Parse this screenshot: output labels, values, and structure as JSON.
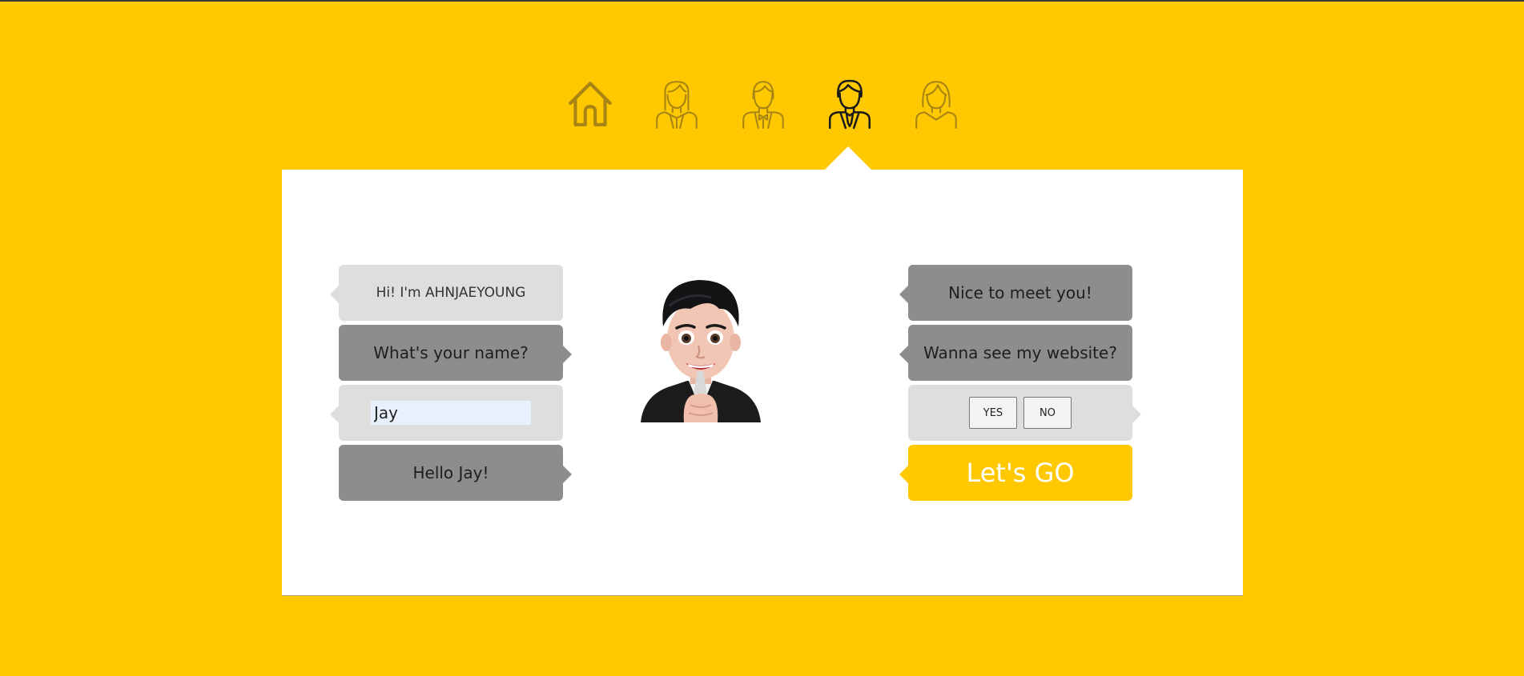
{
  "nav": {
    "items": [
      {
        "icon": "home-icon",
        "active": false
      },
      {
        "icon": "woman-icon",
        "active": false
      },
      {
        "icon": "man-bowtie-icon",
        "active": false
      },
      {
        "icon": "man-suit-icon",
        "active": true
      },
      {
        "icon": "woman-short-hair-icon",
        "active": false
      }
    ],
    "active_color": "#1a1a1a",
    "inactive_color": "#a78414"
  },
  "chat_left": {
    "intro": "Hi! I'm AHNJAEYOUNG",
    "question": "What's your name?",
    "name_value": "Jay",
    "greeting": "Hello Jay!"
  },
  "chat_right": {
    "nice": "Nice to meet you!",
    "website_question": "Wanna see my website?",
    "yes_label": "YES",
    "no_label": "NO",
    "go_label": "Let's GO"
  },
  "colors": {
    "background": "#ffc800",
    "bubble_light": "#dedede",
    "bubble_dark": "#8d8d8d",
    "accent": "#ffc800"
  }
}
